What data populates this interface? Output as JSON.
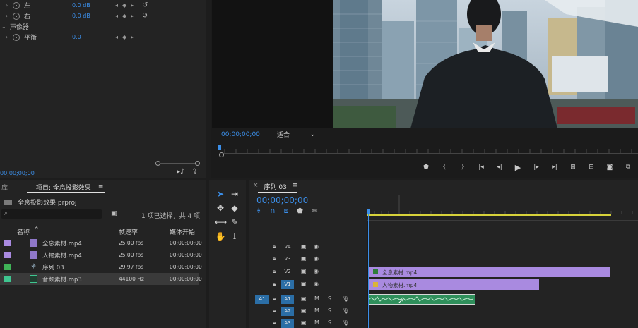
{
  "effect_controls": {
    "rows": [
      {
        "label": "左",
        "value": "0.0 dB"
      },
      {
        "label": "右",
        "value": "0.0 dB"
      },
      {
        "label": "声像器",
        "value": ""
      },
      {
        "label": "平衡",
        "value": "0.0"
      }
    ],
    "timecode": "00;00;00;00"
  },
  "program_monitor": {
    "timecode": "00;00;00;00",
    "fit_label": "适合",
    "fit_arrow": "⌄"
  },
  "project_panel": {
    "lib_tab": "库",
    "active_tab": "项目: 全息投影效果",
    "menu_icon": "≡",
    "file_name": "全息投影效果.prproj",
    "selection_info": "1 项已选择，共 4 项",
    "columns": {
      "name": "名称",
      "fps": "帧速率",
      "start": "媒体开始"
    },
    "items": [
      {
        "name": "全息素材.mp4",
        "fps": "25.00 fps",
        "start": "00;00;00;00",
        "color": "#a98ae0",
        "icon": "video-clip-icon"
      },
      {
        "name": "人物素材.mp4",
        "fps": "25.00 fps",
        "start": "00;00;00;00",
        "color": "#a98ae0",
        "icon": "video-clip-icon"
      },
      {
        "name": "序列 03",
        "fps": "29.97 fps",
        "start": "00;00;00;00",
        "color": "#3fb357",
        "icon": "sequence-icon"
      },
      {
        "name": "音频素材.mp3",
        "fps": "44100 Hz",
        "start": "00;00:00:00",
        "color": "#3fc590",
        "icon": "audio-clip-icon"
      }
    ]
  },
  "timeline": {
    "close_icon": "×",
    "sequence_name": "序列 03",
    "menu_icon": "≡",
    "timecode": "00;00;00;00",
    "tracks": [
      {
        "name": "V4",
        "active": false,
        "type": "video"
      },
      {
        "name": "V3",
        "active": false,
        "type": "video"
      },
      {
        "name": "V2",
        "active": false,
        "type": "video"
      },
      {
        "name": "V1",
        "active": true,
        "type": "video"
      },
      {
        "name": "A1",
        "active": true,
        "type": "audio",
        "source": "A1"
      },
      {
        "name": "A2",
        "active": true,
        "type": "audio"
      },
      {
        "name": "A3",
        "active": true,
        "type": "audio"
      }
    ],
    "clips": [
      {
        "track": "V2",
        "label": "全息素材.mp4",
        "color": "#a98ae0"
      },
      {
        "track": "V1",
        "label": "人物素材.mp4",
        "color": "#a98ae0"
      },
      {
        "track": "A1",
        "label": "",
        "color": "#2f8f5b"
      }
    ],
    "audio_letters": {
      "mute": "M",
      "solo": "S"
    }
  },
  "colors": {
    "accent_blue": "#3b8ee8",
    "clip_purple": "#a98ae0",
    "audio_green": "#2f8f5b",
    "work_area_yellow": "#d7d23a"
  }
}
